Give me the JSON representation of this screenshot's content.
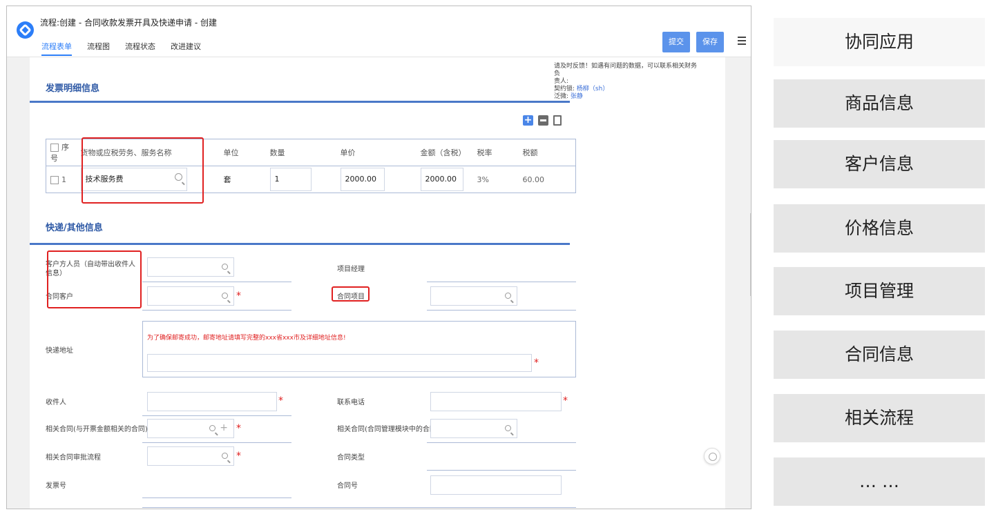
{
  "window": {
    "title": "流程:创建 - 合同收款发票开具及快递申请 - 创建",
    "tabs": [
      {
        "label": "流程表单",
        "active": true
      },
      {
        "label": "流程图",
        "active": false
      },
      {
        "label": "流程状态",
        "active": false
      },
      {
        "label": "改进建议",
        "active": false
      }
    ],
    "submit_label": "提交",
    "save_label": "保存",
    "menu_icon": "list-menu-icon",
    "accent_color": "#2c7ef8"
  },
  "notes": {
    "line1": "请及时反馈！如遇有问题的数据，可以联系相关财务负",
    "line2": "责人:",
    "line3_prefix": "契约锁:",
    "line3_link": "杨柳（sh）",
    "line4_prefix": "泛微:",
    "line4_link": "张静"
  },
  "invoice_section": {
    "title": "发票明细信息",
    "columns": [
      "序号",
      "货物或应税劳务、服务名称",
      "单位",
      "数量",
      "单价",
      "金额（含税）",
      "税率",
      "税额"
    ],
    "rows": [
      {
        "index": "1",
        "name": "技术服务费",
        "unit": "套",
        "qty": "1",
        "price": "2000.00",
        "amount": "2000.00",
        "rate": "3%",
        "tax": "60.00"
      }
    ]
  },
  "other_section": {
    "title": "快递/其他信息",
    "fields": {
      "customer_person": "客户方人员（自动带出收件人信息）",
      "project_manager": "项目经理",
      "contract_customer": "合同客户",
      "contract_project": "合同项目",
      "address": "快递地址",
      "address_hint": "为了确保邮寄成功，邮寄地址请填写完整的xxx省xxx市及详细地址信息!",
      "recipient": "收件人",
      "phone": "联系电话",
      "related_contract": "相关合同(与开票金额相关的合同)",
      "related_contract_module": "相关合同(合同管理模块中的合同)",
      "related_approval": "相关合同审批流程",
      "contract_type": "合同类型",
      "invoice_no": "发票号",
      "contract_no": "合同号"
    },
    "required_mark": "*"
  },
  "side_panel": {
    "items": [
      "协同应用",
      "商品信息",
      "客户信息",
      "价格信息",
      "项目管理",
      "合同信息",
      "相关流程",
      "… …"
    ]
  }
}
